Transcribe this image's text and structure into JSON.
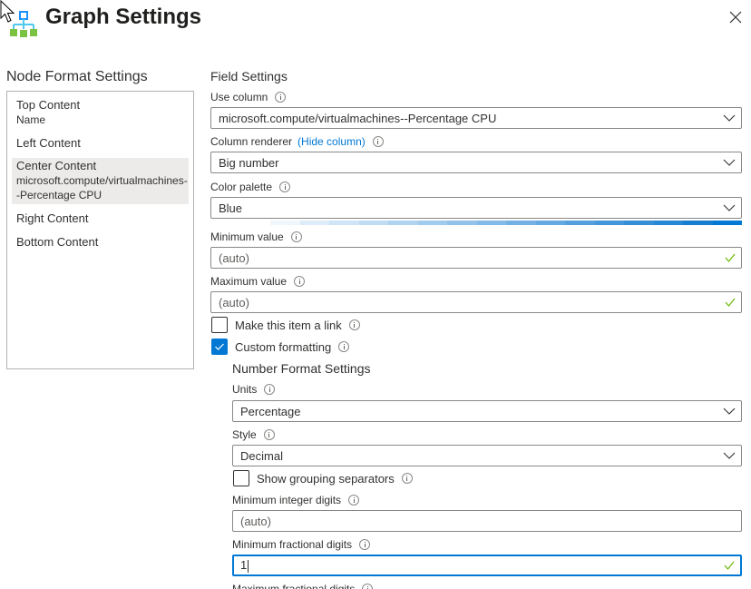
{
  "header": {
    "title": "Graph Settings",
    "logo_icon": "graph-hierarchy-icon",
    "close_icon": "close-icon"
  },
  "node_format": {
    "title": "Node Format Settings",
    "items": [
      {
        "label": "Top Content",
        "sub": "Name",
        "selected": false
      },
      {
        "label": "Left Content",
        "sub": "",
        "selected": false
      },
      {
        "label": "Center Content",
        "sub": "microsoft.compute/virtualmachines--Percentage CPU",
        "selected": true
      },
      {
        "label": "Right Content",
        "sub": "",
        "selected": false
      },
      {
        "label": "Bottom Content",
        "sub": "",
        "selected": false
      }
    ]
  },
  "field_settings": {
    "title": "Field Settings",
    "use_column": {
      "label": "Use column",
      "value": "microsoft.compute/virtualmachines--Percentage CPU"
    },
    "column_renderer": {
      "label": "Column renderer",
      "link": "(Hide column)",
      "value": "Big number"
    },
    "color_palette": {
      "label": "Color palette",
      "value": "Blue",
      "swatches": [
        "#eff6fc",
        "#deecf9",
        "#cfe4f6",
        "#c0dcf3",
        "#b0d3f0",
        "#a1cbed",
        "#92c2ea",
        "#83baE7",
        "#73b1e4",
        "#64a9e1",
        "#559fdc",
        "#4597d9",
        "#368ed5",
        "#2787d2",
        "#177ecf",
        "#0078d4"
      ]
    },
    "minimum_value": {
      "label": "Minimum value",
      "placeholder": "(auto)",
      "valid": true
    },
    "maximum_value": {
      "label": "Maximum value",
      "placeholder": "(auto)",
      "valid": true
    },
    "make_link": {
      "label": "Make this item a link",
      "checked": false
    },
    "custom_formatting": {
      "label": "Custom formatting",
      "checked": true
    }
  },
  "number_format": {
    "title": "Number Format Settings",
    "units": {
      "label": "Units",
      "value": "Percentage"
    },
    "style": {
      "label": "Style",
      "value": "Decimal"
    },
    "grouping": {
      "label": "Show grouping separators",
      "checked": false
    },
    "min_integer_digits": {
      "label": "Minimum integer digits",
      "placeholder": "(auto)"
    },
    "min_fractional_digits": {
      "label": "Minimum fractional digits",
      "value": "1",
      "valid": true
    },
    "max_fractional_digits": {
      "label": "Maximum fractional digits"
    }
  },
  "colors": {
    "accent": "#0078d4",
    "valid_check": "#6bb700",
    "selected_item_bg": "#edebe9"
  }
}
